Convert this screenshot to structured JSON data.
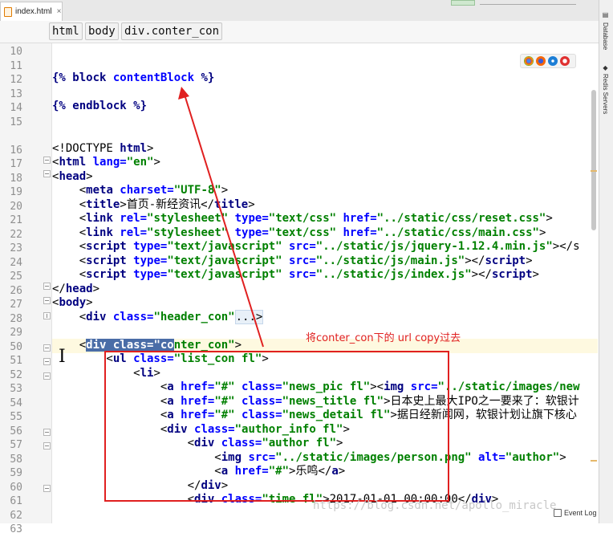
{
  "tab": {
    "label": "index.html",
    "close": "×"
  },
  "breadcrumb": [
    "html",
    "body",
    "div.conter_con"
  ],
  "side_panels": [
    "Database",
    "Redis Servers"
  ],
  "event_log": "Event Log",
  "annotation": "将conter_con下的 url copy过去",
  "watermark": "https://blog.csdn.net/apollo_miracle",
  "colors": {
    "annotation": "#e02020",
    "selection": "#4a6da7",
    "current_line": "#fef9e0"
  },
  "browser_icons": [
    "chrome-icon",
    "firefox-icon",
    "safari-icon",
    "opera-icon"
  ],
  "line_numbers": [
    "10",
    "11",
    "12",
    "13",
    "14",
    "15",
    "16",
    "17",
    "18",
    "19",
    "20",
    "21",
    "22",
    "23",
    "24",
    "25",
    "26",
    "27",
    "28",
    "29",
    "50",
    "51",
    "52",
    "53",
    "54",
    "55",
    "56",
    "57",
    "58",
    "59",
    "60",
    "61",
    "62",
    "63"
  ],
  "code": {
    "l10": "",
    "l12a": "{% ",
    "l12b": "block",
    "l12c": " contentBlock",
    "l12d": " %}",
    "l14a": "{% ",
    "l14b": "endblock",
    "l14c": " %}",
    "l17a": "<!DOCTYPE ",
    "l17b": "html",
    "l17c": ">",
    "l18a": "<",
    "l18b": "html",
    "l18c": " lang=",
    "l18d": "\"en\"",
    "l18e": ">",
    "l19a": "<",
    "l19b": "head",
    "l19c": ">",
    "l20a": "    <",
    "l20b": "meta",
    "l20c": " charset=",
    "l20d": "\"UTF-8\"",
    "l20e": ">",
    "l21a": "    <",
    "l21b": "title",
    "l21c": ">首页-新经资讯</",
    "l21d": "title",
    "l21e": ">",
    "l22a": "    <",
    "l22b": "link",
    "l22c": " rel=",
    "l22d": "\"stylesheet\"",
    "l22e": " type=",
    "l22f": "\"text/css\"",
    "l22g": " href=",
    "l22h": "\"../static/css/reset.css\"",
    "l22i": ">",
    "l23a": "    <",
    "l23b": "link",
    "l23c": " rel=",
    "l23d": "\"stylesheet\"",
    "l23e": " type=",
    "l23f": "\"text/css\"",
    "l23g": " href=",
    "l23h": "\"../static/css/main.css\"",
    "l23i": ">",
    "l24a": "    <",
    "l24b": "script",
    "l24c": " type=",
    "l24d": "\"text/javascript\"",
    "l24e": " src=",
    "l24f": "\"../static/js/jquery-1.12.4.min.js\"",
    "l24g": "></s",
    "l25a": "    <",
    "l25b": "script",
    "l25c": " type=",
    "l25d": "\"text/javascript\"",
    "l25e": " src=",
    "l25f": "\"../static/js/main.js\"",
    "l25g": "></",
    "l25h": "script",
    "l25i": ">",
    "l26a": "    <",
    "l26b": "script",
    "l26c": " type=",
    "l26d": "\"text/javascript\"",
    "l26e": " src=",
    "l26f": "\"../static/js/index.js\"",
    "l26g": "></",
    "l26h": "script",
    "l26i": ">",
    "l27a": "</",
    "l27b": "head",
    "l27c": ">",
    "l28a": "<",
    "l28b": "body",
    "l28c": ">",
    "l29a": "    <",
    "l29b": "div",
    "l29c": " class=",
    "l29d": "\"header_con\"",
    "l29e": "...>",
    "l52a": "    <",
    "l52sel": "div class=\"co",
    "l52b": "nter_con\"",
    "l52c": ">",
    "l53a": "        <",
    "l53b": "ul",
    "l53c": " class=",
    "l53d": "\"list_con fl\"",
    "l53e": ">",
    "l54a": "            <",
    "l54b": "li",
    "l54c": ">",
    "l55a": "                <",
    "l55b": "a",
    "l55c": " href=",
    "l55d": "\"#\"",
    "l55e": " class=",
    "l55f": "\"news_pic fl\"",
    "l55g": "><",
    "l55h": "img",
    "l55i": " src=",
    "l55j": "\"../static/images/new",
    "l56a": "                <",
    "l56b": "a",
    "l56c": " href=",
    "l56d": "\"#\"",
    "l56e": " class=",
    "l56f": "\"news_title fl\"",
    "l56g": ">日本史上最大IPO之一要来了：软银计",
    "l57a": "                <",
    "l57b": "a",
    "l57c": " href=",
    "l57d": "\"#\"",
    "l57e": " class=",
    "l57f": "\"news_detail fl\"",
    "l57g": ">据日经新闻网，软银计划让旗下核心",
    "l58a": "                <",
    "l58b": "div",
    "l58c": " class=",
    "l58d": "\"author_info fl\"",
    "l58e": ">",
    "l59a": "                    <",
    "l59b": "div",
    "l59c": " class=",
    "l59d": "\"author fl\"",
    "l59e": ">",
    "l60a": "                        <",
    "l60b": "img",
    "l60c": " src=",
    "l60d": "\"../static/images/person.png\"",
    "l60e": " alt=",
    "l60f": "\"author\"",
    "l60g": ">",
    "l61a": "                        <",
    "l61b": "a",
    "l61c": " href=",
    "l61d": "\"#\"",
    "l61e": ">乐鸣</",
    "l61f": "a",
    "l61g": ">",
    "l62a": "                    </",
    "l62b": "div",
    "l62c": ">",
    "l63a": "                    <",
    "l63b": "div",
    "l63c": " class=",
    "l63d": "\"time fl\"",
    "l63e": ">2017-01-01 00:00:00</",
    "l63f": "div",
    "l63g": ">"
  }
}
